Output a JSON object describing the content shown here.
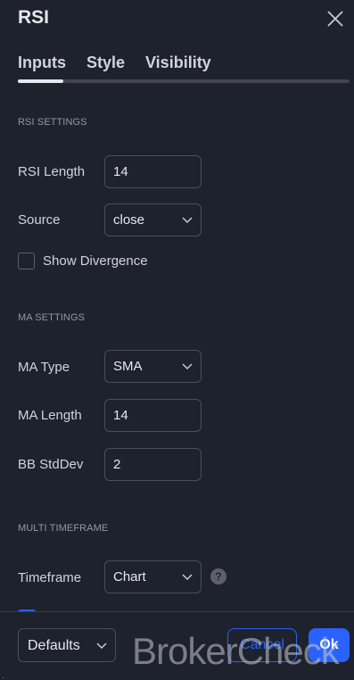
{
  "dialog": {
    "title": "RSI"
  },
  "tabs": [
    {
      "label": "Inputs",
      "active": true
    },
    {
      "label": "Style",
      "active": false
    },
    {
      "label": "Visibility",
      "active": false
    }
  ],
  "sections": {
    "rsi": "RSI SETTINGS",
    "ma": "MA SETTINGS",
    "mtf": "MULTI TIMEFRAME"
  },
  "fields": {
    "rsi_length": {
      "label": "RSI Length",
      "value": "14"
    },
    "source": {
      "label": "Source",
      "value": "close"
    },
    "show_divergence": {
      "label": "Show Divergence",
      "checked": false
    },
    "ma_type": {
      "label": "MA Type",
      "value": "SMA"
    },
    "ma_length": {
      "label": "MA Length",
      "value": "14"
    },
    "bb_stddev": {
      "label": "BB StdDev",
      "value": "2"
    },
    "timeframe": {
      "label": "Timeframe",
      "value": "Chart"
    }
  },
  "help_glyph": "?",
  "footer": {
    "defaults_label": "Defaults",
    "cancel_label": "Cancel",
    "ok_label": "Ok"
  },
  "watermark": "BrokerCheck",
  "colors": {
    "background": "#1e222d",
    "accent": "#2962ff",
    "text": "#d1d4dc",
    "muted": "#9598a1",
    "border": "#4a4e5a"
  },
  "icons": [
    "close-icon",
    "chevron-down-icon",
    "help-icon"
  ]
}
